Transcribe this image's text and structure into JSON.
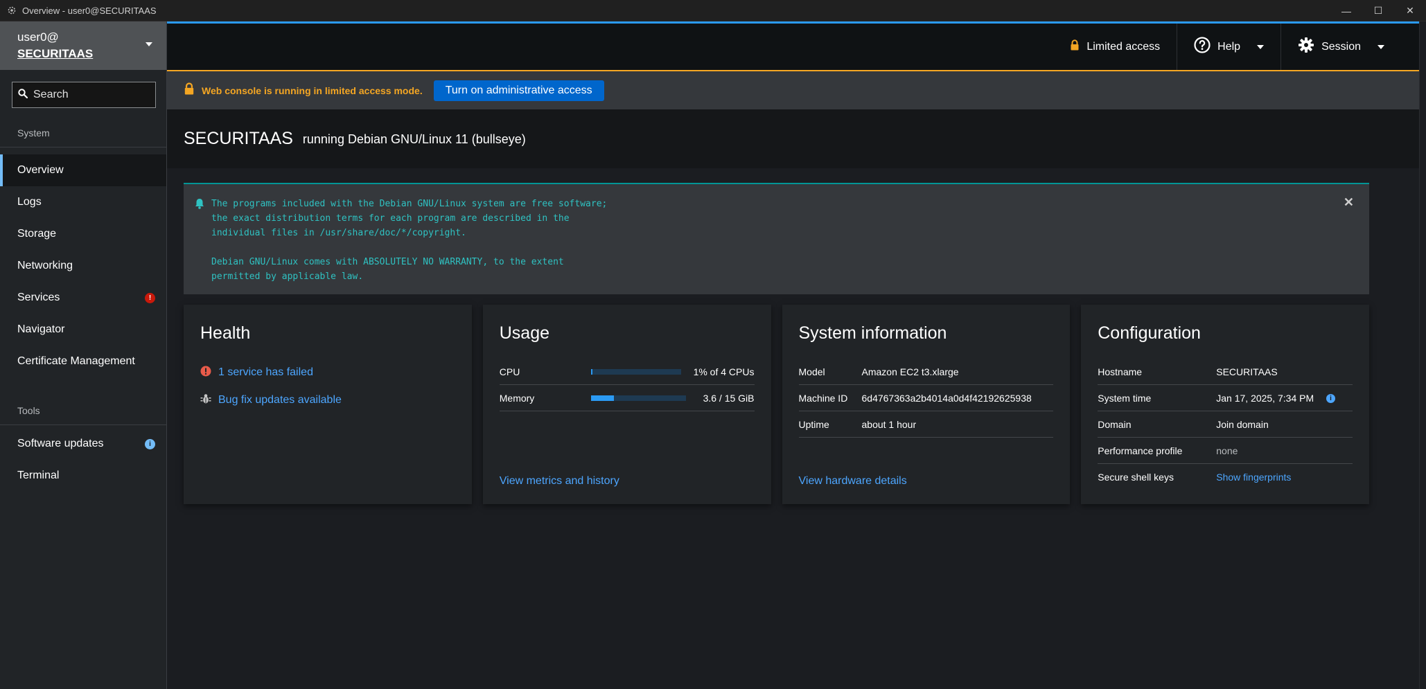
{
  "window": {
    "title": "Overview - user0@SECURITAAS",
    "minimize": "—",
    "maximize": "☐",
    "close": "✕"
  },
  "sidebar": {
    "user": "user0@",
    "host": "SECURITAAS",
    "search_label": "Search",
    "system_title": "System",
    "tools_title": "Tools",
    "system_items": [
      {
        "label": "Overview",
        "active": true
      },
      {
        "label": "Logs"
      },
      {
        "label": "Storage"
      },
      {
        "label": "Networking"
      },
      {
        "label": "Services",
        "badge": "!"
      },
      {
        "label": "Navigator"
      },
      {
        "label": "Certificate Management"
      }
    ],
    "tool_items": [
      {
        "label": "Software updates",
        "badge": "i"
      },
      {
        "label": "Terminal"
      }
    ]
  },
  "topbar": {
    "limited_access": "Limited access",
    "help": "Help",
    "session": "Session"
  },
  "alert": {
    "message": "Web console is running in limited access mode.",
    "button": "Turn on administrative access"
  },
  "page": {
    "hostname": "SECURITAAS",
    "os": "running Debian GNU/Linux 11 (bullseye)"
  },
  "motd": {
    "text": "The programs included with the Debian GNU/Linux system are free software;\nthe exact distribution terms for each program are described in the\nindividual files in /usr/share/doc/*/copyright.\n\nDebian GNU/Linux comes with ABSOLUTELY NO WARRANTY, to the extent\npermitted by applicable law.",
    "close": "✕"
  },
  "health": {
    "title": "Health",
    "failed": "1 service has failed",
    "updates": "Bug fix updates available"
  },
  "usage": {
    "title": "Usage",
    "cpu_label": "CPU",
    "cpu_value": "1% of 4 CPUs",
    "cpu_fraction": 0.01,
    "mem_label": "Memory",
    "mem_value": "3.6 / 15 GiB",
    "mem_fraction": 0.24,
    "link": "View metrics and history"
  },
  "sysinfo": {
    "title": "System information",
    "rows": [
      {
        "k": "Model",
        "v": "Amazon EC2 t3.xlarge"
      },
      {
        "k": "Machine ID",
        "v": "6d4767363a2b4014a0d4f42192625938"
      },
      {
        "k": "Uptime",
        "v": "about 1 hour"
      }
    ],
    "link": "View hardware details"
  },
  "config": {
    "title": "Configuration",
    "hostname_k": "Hostname",
    "hostname_v": "SECURITAAS",
    "time_k": "System time",
    "time_v": "Jan 17, 2025, 7:34 PM",
    "domain_k": "Domain",
    "domain_v": "Join domain",
    "perf_k": "Performance profile",
    "perf_v": "none",
    "ssh_k": "Secure shell keys",
    "ssh_v": "Show fingerprints"
  },
  "colors": {
    "accent_blue": "#2b9af3",
    "warning": "#f4a623",
    "danger": "#c9190b",
    "motd_teal": "#2fc2c2"
  }
}
